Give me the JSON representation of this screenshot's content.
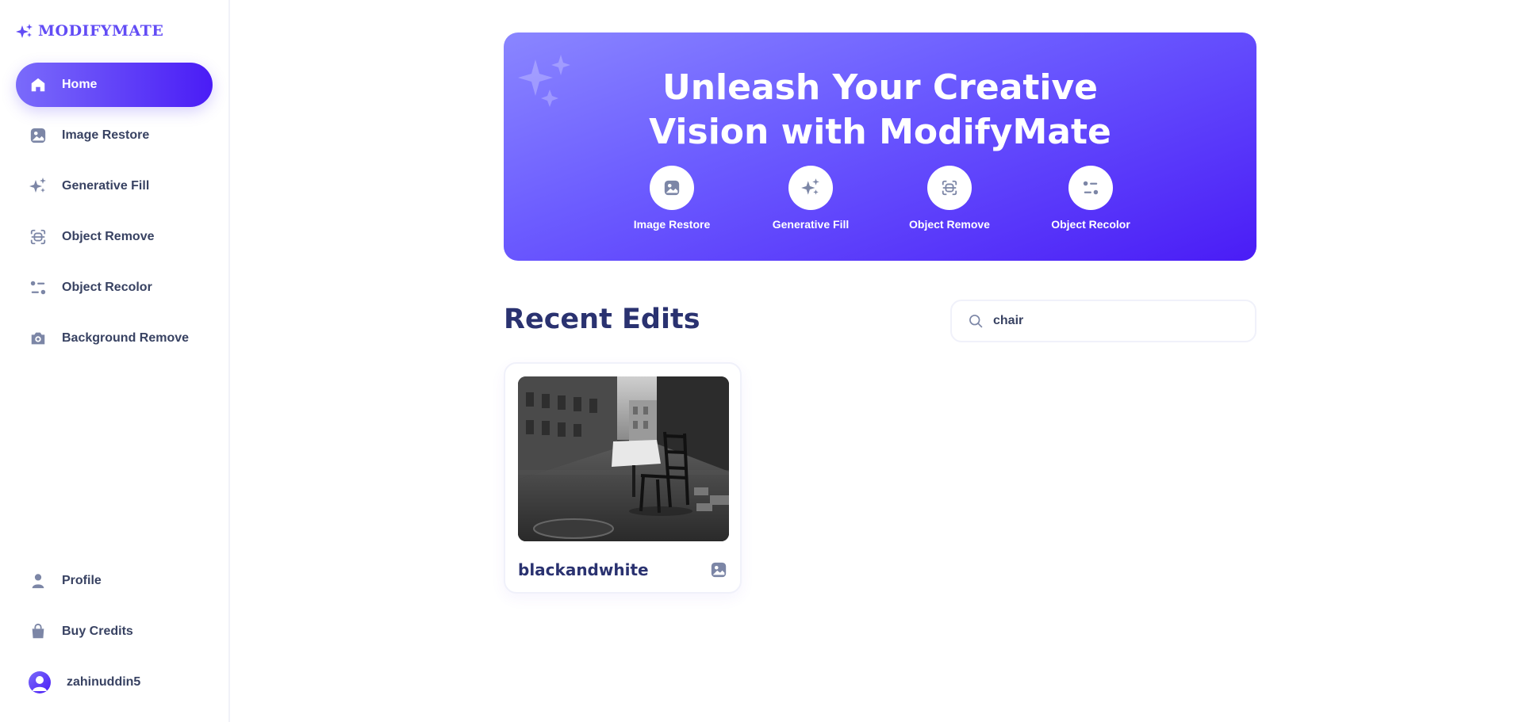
{
  "app": {
    "logo_text": "MODIFYMATE",
    "accent": "#624cf5"
  },
  "sidebar": {
    "items": [
      {
        "label": "Home",
        "icon": "home-icon",
        "active": true
      },
      {
        "label": "Image Restore",
        "icon": "image-icon"
      },
      {
        "label": "Generative Fill",
        "icon": "sparkles-icon"
      },
      {
        "label": "Object Remove",
        "icon": "scan-icon"
      },
      {
        "label": "Object Recolor",
        "icon": "filter-icon"
      },
      {
        "label": "Background Remove",
        "icon": "camera-icon"
      }
    ],
    "bottom": [
      {
        "label": "Profile",
        "icon": "user-icon"
      },
      {
        "label": "Buy Credits",
        "icon": "bag-icon"
      }
    ],
    "username": "zahinuddin5"
  },
  "hero": {
    "title_line1": "Unleash Your Creative",
    "title_line2": "Vision with ModifyMate",
    "features": [
      {
        "label": "Image Restore",
        "icon": "image-icon"
      },
      {
        "label": "Generative Fill",
        "icon": "sparkles-icon"
      },
      {
        "label": "Object Remove",
        "icon": "scan-icon"
      },
      {
        "label": "Object Recolor",
        "icon": "filter-icon"
      }
    ]
  },
  "recent": {
    "title": "Recent Edits",
    "search_value": "chair",
    "cards": [
      {
        "title": "blackandwhite",
        "icon": "image-icon"
      }
    ]
  }
}
